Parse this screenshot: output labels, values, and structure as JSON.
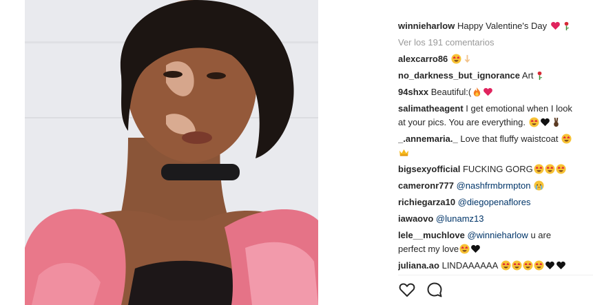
{
  "post": {
    "caption_user": "winnieharlow",
    "caption_text": "Happy Valentine's Day",
    "caption_icons": [
      "heart-icon",
      "rose-icon"
    ],
    "view_all_comments": "Ver los 191 comentarios"
  },
  "comments": [
    {
      "user": "alexcarro86",
      "text": "",
      "icons": [
        "heart-eyes-icon",
        "hand-pointing-down-icon"
      ]
    },
    {
      "user": "no_darkness_but_ignorance",
      "text": "Art",
      "icons": [
        "rose-icon"
      ]
    },
    {
      "user": "94shxx",
      "text": "Beautiful:(",
      "icons": [
        "fire-icon",
        "heart-icon"
      ]
    },
    {
      "user": "salimatheagent",
      "text": "I get emotional when I look at your pics. You are everything.",
      "icons": [
        "heart-eyes-icon",
        "black-heart-icon",
        "victory-hand-icon"
      ]
    },
    {
      "user": "_.annemaria._",
      "text": "Love that fluffy waistcoat",
      "icons": [
        "heart-eyes-icon",
        "crown-icon"
      ]
    },
    {
      "user": "bigsexyofficial",
      "text": "FUCKING GORG",
      "icons": [
        "heart-eyes-icon",
        "heart-eyes-icon",
        "heart-eyes-icon"
      ]
    },
    {
      "user": "cameronr777",
      "mention": "@nashfrmbrmpton",
      "text": "",
      "icons": [
        "crying-face-icon"
      ]
    },
    {
      "user": "richiegarza10",
      "mention": "@diegopenaflores",
      "text": "",
      "icons": []
    },
    {
      "user": "iawaovo",
      "mention": "@lunamz13",
      "text": "",
      "icons": []
    },
    {
      "user": "lele__muchlove",
      "mention": "@winnieharlow",
      "text": "u are perfect my love",
      "icons": [
        "heart-eyes-icon",
        "black-heart-icon"
      ]
    },
    {
      "user": "juliana.ao",
      "text": "LINDAAAAAA",
      "icons": [
        "heart-eyes-icon",
        "heart-eyes-icon",
        "heart-eyes-icon",
        "heart-eyes-icon",
        "black-heart-icon",
        "black-heart-icon"
      ]
    }
  ],
  "actions": {
    "like_icon": "heart-outline-icon",
    "comment_icon": "speech-bubble-icon"
  },
  "colors": {
    "username": "#262626",
    "mention": "#003569",
    "muted": "#999999",
    "divider": "#efefef"
  }
}
